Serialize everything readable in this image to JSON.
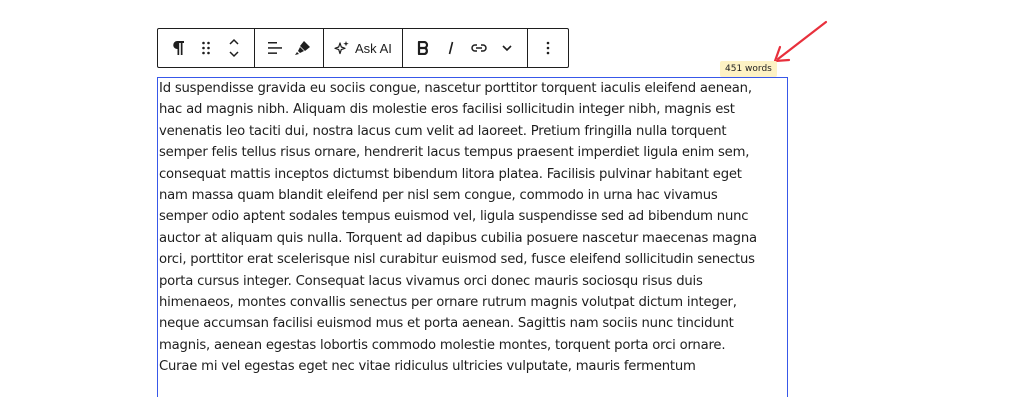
{
  "toolbar": {
    "groups": [
      {
        "items": [
          "paragraph-icon",
          "drag-handle-icon",
          "move-up-down-icon"
        ]
      },
      {
        "items": [
          "align-left-icon",
          "highlighter-icon"
        ]
      },
      {
        "items": [
          "ai-sparkle-icon"
        ],
        "ask_ai_label": "Ask AI"
      },
      {
        "items": [
          "bold-icon",
          "italic-icon",
          "link-icon",
          "chevron-down-icon"
        ]
      },
      {
        "items": [
          "more-options-icon"
        ]
      }
    ],
    "ask_ai_label": "Ask AI"
  },
  "word_count": {
    "label": "451 words"
  },
  "annotation": {
    "arrow_color": "#e8303c"
  },
  "colors": {
    "block_border": "#3858e9",
    "badge_bg": "#fdf2c4",
    "text": "#1e1e1e"
  },
  "paragraph": {
    "lines": [
      "Id suspendisse gravida eu sociis congue, nascetur porttitor torquent iaculis eleifend aenean,",
      "hac ad magnis nibh. Aliquam dis molestie eros facilisi sollicitudin integer nibh, magnis est",
      "venenatis leo taciti dui, nostra lacus cum velit ad laoreet. Pretium fringilla nulla torquent",
      "semper felis tellus risus ornare, hendrerit lacus tempus praesent imperdiet ligula enim sem,",
      "consequat mattis inceptos dictumst bibendum litora platea. Facilisis pulvinar habitant eget",
      "nam massa quam blandit eleifend per nisl sem congue, commodo in urna hac vivamus",
      "semper odio aptent sodales tempus euismod vel, ligula suspendisse sed ad bibendum nunc",
      "auctor at aliquam quis nulla. Torquent ad dapibus cubilia posuere nascetur maecenas magna",
      "orci, porttitor erat scelerisque nisl curabitur euismod sed, fusce eleifend sollicitudin senectus",
      "porta cursus integer. Consequat lacus vivamus orci donec mauris sociosqu risus duis",
      "himenaeos, montes convallis senectus per ornare rutrum magnis volutpat dictum integer,",
      "neque accumsan facilisi euismod mus et porta aenean. Sagittis nam sociis nunc tincidunt",
      "magnis, aenean egestas lobortis commodo molestie montes, torquent porta orci ornare.",
      "Curae mi vel egestas eget nec vitae ridiculus ultricies vulputate, mauris fermentum"
    ]
  }
}
